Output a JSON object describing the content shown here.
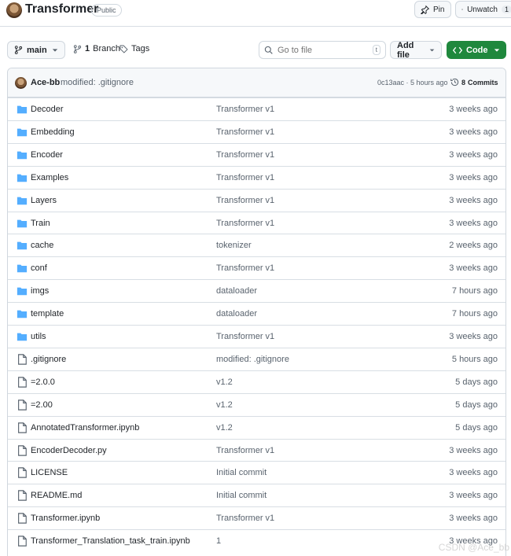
{
  "repo": {
    "name": "Transformer",
    "visibility": "Public",
    "pin_label": "Pin",
    "watch_label": "Unwatch",
    "watch_count": "1"
  },
  "toolbar": {
    "branch": "main",
    "branch_count": "1",
    "branch_label": "Branch",
    "tags_label": "Tags",
    "search_placeholder": "Go to file",
    "search_key": "t",
    "add_file_label": "Add file",
    "code_label": "Code"
  },
  "commit": {
    "author": "Ace-bb",
    "message": "modified: .gitignore",
    "hash_time": "0c13aac · 5 hours ago",
    "commits_count": "8",
    "commits_label": "Commits"
  },
  "files": [
    {
      "type": "dir",
      "name": "Decoder",
      "message": "Transformer v1",
      "age": "3 weeks ago"
    },
    {
      "type": "dir",
      "name": "Embedding",
      "message": "Transformer v1",
      "age": "3 weeks ago"
    },
    {
      "type": "dir",
      "name": "Encoder",
      "message": "Transformer v1",
      "age": "3 weeks ago"
    },
    {
      "type": "dir",
      "name": "Examples",
      "message": "Transformer v1",
      "age": "3 weeks ago"
    },
    {
      "type": "dir",
      "name": "Layers",
      "message": "Transformer v1",
      "age": "3 weeks ago"
    },
    {
      "type": "dir",
      "name": "Train",
      "message": "Transformer v1",
      "age": "3 weeks ago"
    },
    {
      "type": "dir",
      "name": "cache",
      "message": "tokenizer",
      "age": "2 weeks ago"
    },
    {
      "type": "dir",
      "name": "conf",
      "message": "Transformer v1",
      "age": "3 weeks ago"
    },
    {
      "type": "dir",
      "name": "imgs",
      "message": "dataloader",
      "age": "7 hours ago"
    },
    {
      "type": "dir",
      "name": "template",
      "message": "dataloader",
      "age": "7 hours ago"
    },
    {
      "type": "dir",
      "name": "utils",
      "message": "Transformer v1",
      "age": "3 weeks ago"
    },
    {
      "type": "file",
      "name": ".gitignore",
      "message": "modified: .gitignore",
      "age": "5 hours ago"
    },
    {
      "type": "file",
      "name": "=2.0.0",
      "message": "v1.2",
      "age": "5 days ago"
    },
    {
      "type": "file",
      "name": "=2.00",
      "message": "v1.2",
      "age": "5 days ago"
    },
    {
      "type": "file",
      "name": "AnnotatedTransformer.ipynb",
      "message": "v1.2",
      "age": "5 days ago"
    },
    {
      "type": "file",
      "name": "EncoderDecoder.py",
      "message": "Transformer v1",
      "age": "3 weeks ago"
    },
    {
      "type": "file",
      "name": "LICENSE",
      "message": "Initial commit",
      "age": "3 weeks ago"
    },
    {
      "type": "file",
      "name": "README.md",
      "message": "Initial commit",
      "age": "3 weeks ago"
    },
    {
      "type": "file",
      "name": "Transformer.ipynb",
      "message": "Transformer v1",
      "age": "3 weeks ago"
    },
    {
      "type": "file",
      "name": "Transformer_Translation_task_train.ipynb",
      "message": "1",
      "age": "3 weeks ago"
    }
  ],
  "watermark": "CSDN @Ace_bb",
  "colors": {
    "folder": "#54aeff",
    "code_button": "#1f883d",
    "muted_text": "#59636e",
    "border": "#d0d7de"
  }
}
